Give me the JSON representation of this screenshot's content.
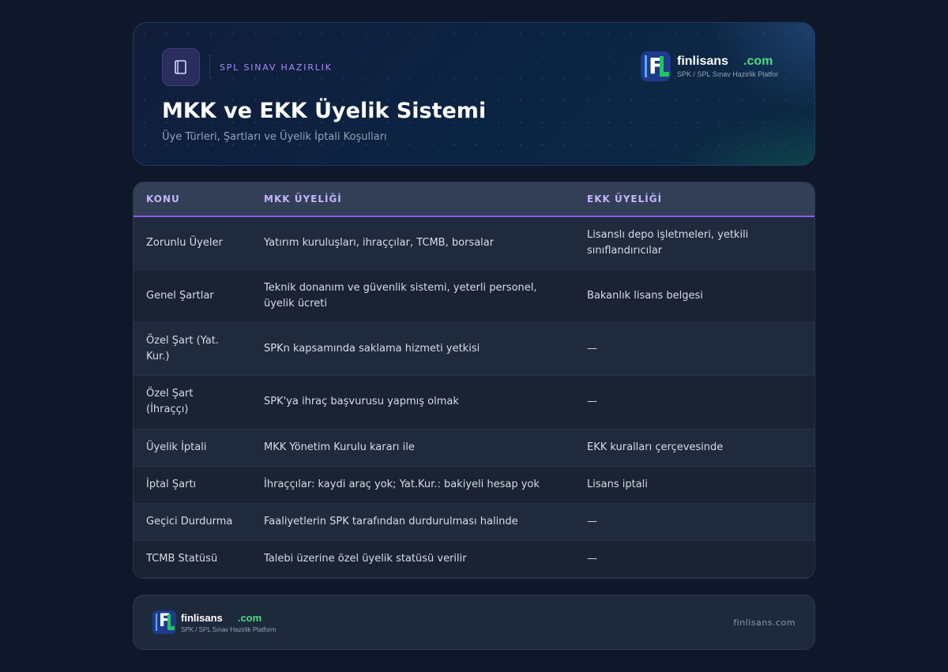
{
  "header": {
    "kicker": "SPL SINAV HAZIRLIK",
    "title": "MKK ve EKK Üyelik Sistemi",
    "subtitle": "Üye Türleri, Şartları ve Üyelik İptali Koşulları",
    "icon": "book-icon"
  },
  "brand": {
    "name": "finlisans",
    "suffix": ".com",
    "tagline": "SPK / SPL Sınav Hazirlik Platfor",
    "logo_letter": "F",
    "colors": {
      "primary": "#1e3a8a",
      "accent": "#22c55e",
      "highlight": "#60a5fa"
    }
  },
  "table": {
    "columns": [
      "KONU",
      "MKK ÜYELİĞİ",
      "EKK ÜYELİĞİ"
    ],
    "rows": [
      [
        "Zorunlu Üyeler",
        "Yatırım kuruluşları, ihraççılar, TCMB, borsalar",
        "Lisanslı depo işletmeleri, yetkili sınıflandırıcılar"
      ],
      [
        "Genel Şartlar",
        "Teknik donanım ve güvenlik sistemi, yeterli personel, üyelik ücreti",
        "Bakanlık lisans belgesi"
      ],
      [
        "Özel Şart (Yat. Kur.)",
        "SPKn kapsamında saklama hizmeti yetkisi",
        "—"
      ],
      [
        "Özel Şart (İhraççı)",
        "SPK'ya ihraç başvurusu yapmış olmak",
        "—"
      ],
      [
        "Üyelik İptali",
        "MKK Yönetim Kurulu kararı ile",
        "EKK kuralları çerçevesinde"
      ],
      [
        "İptal Şartı",
        "İhraççılar: kaydi araç yok; Yat.Kur.: bakiyeli hesap yok",
        "Lisans iptali"
      ],
      [
        "Geçici Durdurma",
        "Faaliyetlerin SPK tarafından durdurulması halinde",
        "—"
      ],
      [
        "TCMB Statüsü",
        "Talebi üzerine özel üyelik statüsü verilir",
        "—"
      ]
    ]
  },
  "footer": {
    "brand_name": "finlisans",
    "brand_suffix": ".com",
    "brand_tagline": "SPK / SPL Sınav Hazirlik Platform",
    "site": "finlisans.com"
  },
  "colors": {
    "background": "#0f172a",
    "accent_purple": "#8b5cf6",
    "header_text": "#c4b5fd"
  }
}
